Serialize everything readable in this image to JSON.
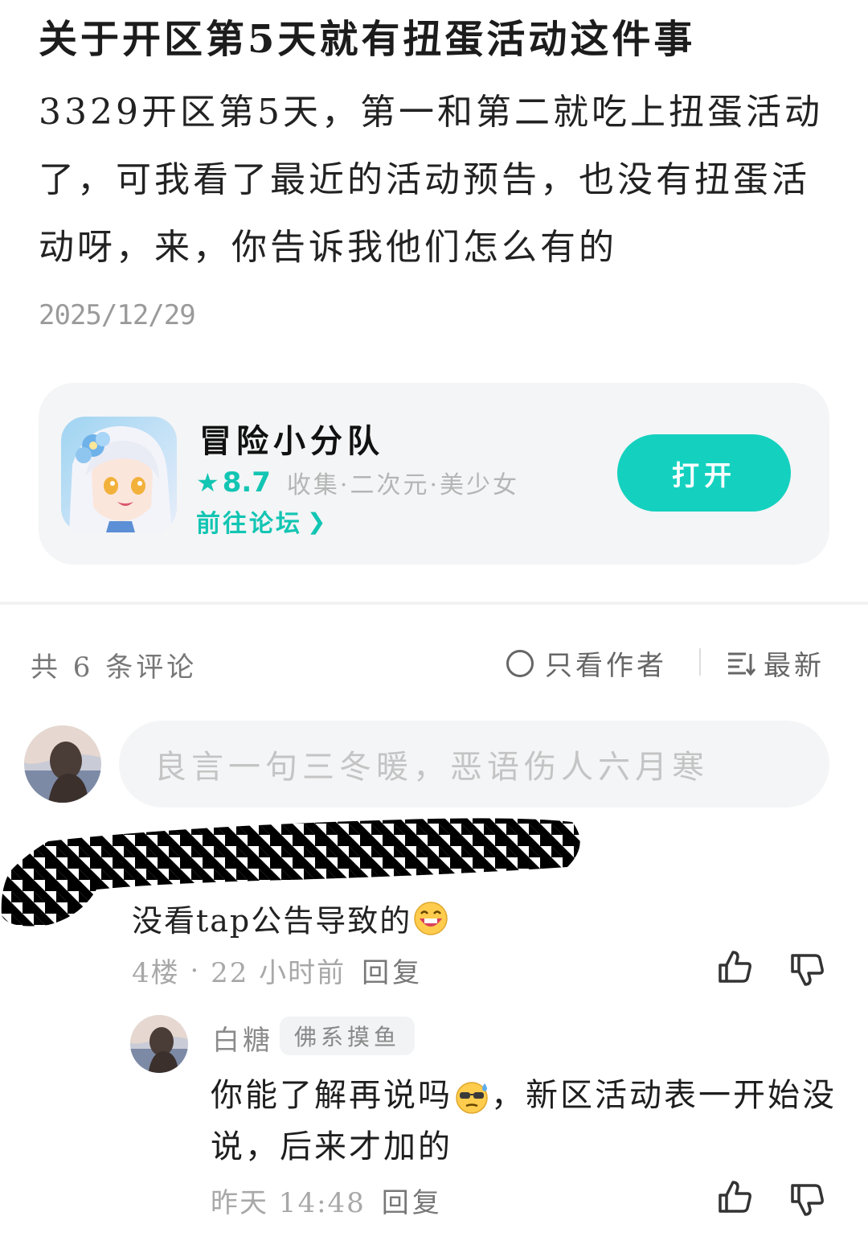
{
  "post": {
    "title": "关于开区第5天就有扭蛋活动这件事",
    "body": "3329开区第5天，第一和第二就吃上扭蛋活动了，可我看了最近的活动预告，也没有扭蛋活动呀，来，你告诉我他们怎么有的",
    "date": "2025/12/29"
  },
  "game_card": {
    "name": "冒险小分队",
    "rating": "8.7",
    "tags": "收集·二次元·美少女",
    "forum_link": "前往论坛",
    "open_label": "打开",
    "icon": "anime-girl-game-icon",
    "accent": "#14d1bf"
  },
  "comments_header": {
    "count_label": "共 6 条评论",
    "author_only": "只看作者",
    "sort_label": "最新"
  },
  "comment_input": {
    "placeholder": "良言一句三冬暖，恶语伤人六月寒"
  },
  "comments": [
    {
      "text": "没看tap公告导致的",
      "emoji": "grinning-face-emoji",
      "floor": "4楼",
      "time": "22 小时前",
      "reply": "回复",
      "replies": [
        {
          "user": "白糖",
          "badge": "佛系摸鱼",
          "text_part1": "你能了解再说吗",
          "emoji": "sweat-sunglasses-emoji",
          "text_part2": "，新区活动表一开始没说，后来才加的",
          "time": "昨天 14:48",
          "reply": "回复"
        }
      ]
    }
  ]
}
